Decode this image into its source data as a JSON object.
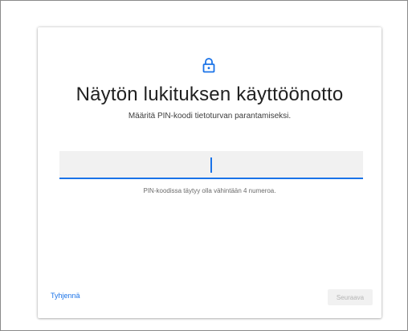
{
  "dialog": {
    "title": "Näytön lukituksen käyttöönotto",
    "subtitle": "Määritä PIN-koodi tietoturvan parantamiseksi.",
    "lock_icon": "lock-icon",
    "pin_field": {
      "value": "",
      "placeholder": ""
    },
    "hint": "PIN-koodissa täytyy olla vähintään 4 numeroa.",
    "clear_label": "Tyhjennä",
    "next_label": "Seuraava"
  },
  "colors": {
    "accent": "#1a73e8",
    "field_background": "#f1f1f1",
    "disabled_text": "#b4b4b4",
    "title_text": "#212121"
  }
}
